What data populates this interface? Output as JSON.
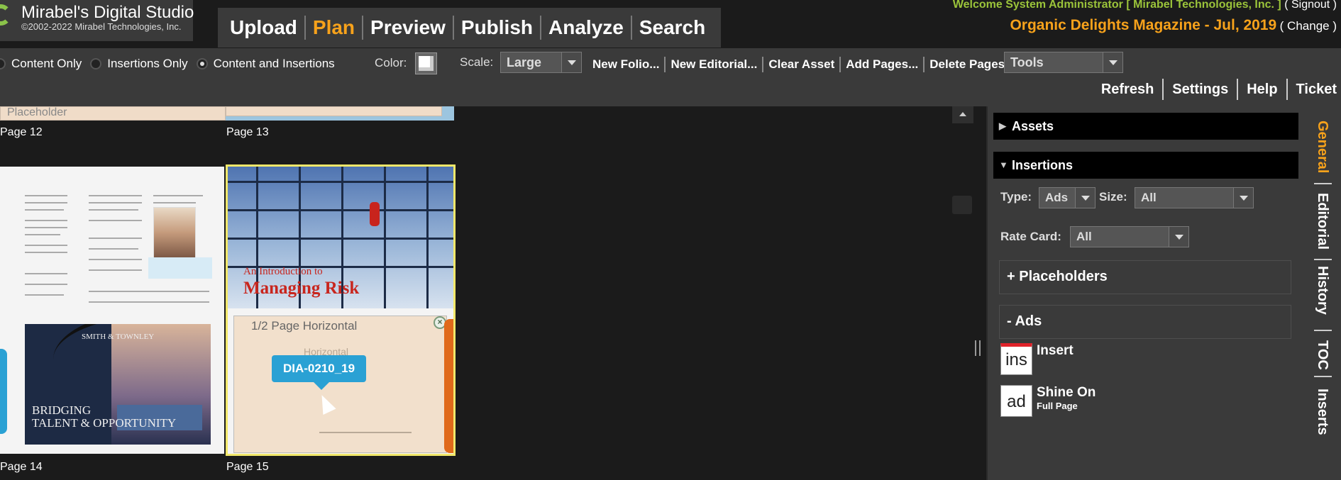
{
  "brand": {
    "name": "Mirabel's Digital Studio",
    "copyright": "©2002-2022 Mirabel Technologies, Inc."
  },
  "nav": [
    "Upload",
    "Plan",
    "Preview",
    "Publish",
    "Analyze",
    "Search"
  ],
  "nav_active": "Plan",
  "user": {
    "welcome": "Welcome System Administrator [ Mirabel Technologies, Inc. ]",
    "signout": "( Signout )"
  },
  "issue": {
    "name": "Organic Delights Magazine - Jul, 2019",
    "change": "( Change )"
  },
  "toolbar": {
    "view_options": [
      "Content Only",
      "Insertions Only",
      "Content and Insertions"
    ],
    "view_selected": "Content and Insertions",
    "color_label": "Color:",
    "scale_label": "Scale:",
    "scale_value": "Large",
    "actions": [
      "New Folio...",
      "New Editorial...",
      "Clear Asset",
      "Add Pages...",
      "Delete Pages"
    ],
    "tools_value": "Tools",
    "right_actions": [
      "Refresh",
      "Settings",
      "Help",
      "Ticket"
    ]
  },
  "pages": {
    "top_labels": [
      "Page 12",
      "Page 13"
    ],
    "bottom_labels": [
      "Page 14",
      "Page 15"
    ],
    "top_placeholder_text": "Placeholder",
    "page14_headline_1": "BRIDGING",
    "page14_headline_2": "TALENT & OPPORTUNITY",
    "page14_logo": "SMITH & TOWNLEY",
    "page15_head_1": "An Introduction to",
    "page15_head_2": "Managing Risk",
    "placeholder_title": "1/2 Page Horizontal",
    "placeholder_faint": "Horizontal",
    "ad_tag": "DIA-0210_19"
  },
  "panel": {
    "assets_label": "Assets",
    "insertions_label": "Insertions",
    "type_label": "Type:",
    "type_value": "Ads",
    "size_label": "Size:",
    "size_value": "All",
    "ratecard_label": "Rate Card:",
    "ratecard_value": "All",
    "placeholders_label": "+ Placeholders",
    "ads_label": "- Ads",
    "ads": [
      {
        "icon": "ins",
        "name": "Insert",
        "sub": ""
      },
      {
        "icon": "ad",
        "name": "Shine On",
        "sub": "Full Page"
      }
    ]
  },
  "side_tabs": [
    "General",
    "Editorial",
    "History",
    "TOC",
    "Inserts"
  ],
  "side_tab_active": "General",
  "colors": {
    "accent": "#f7a21b",
    "welcome": "#9bc43a",
    "tag": "#2aa1d4",
    "selection": "#f2e86a"
  }
}
